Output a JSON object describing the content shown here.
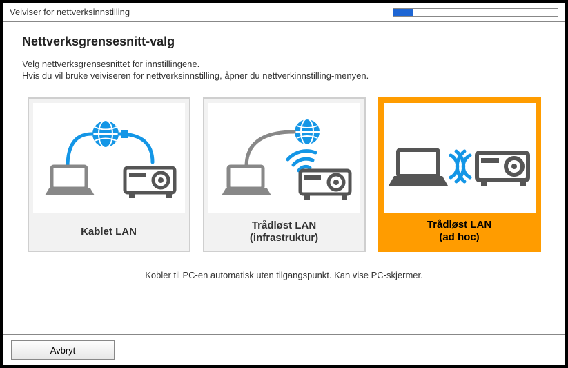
{
  "titlebar": {
    "text": "Veiviser for nettverksinnstilling"
  },
  "heading": "Nettverksgrensesnitt-valg",
  "sub1": "Velg nettverksgrensesnittet for innstillingene.",
  "sub2": "Hvis du vil bruke veiviseren for nettverksinnstilling, åpner du nettverkinnstilling-menyen.",
  "options": {
    "wired": {
      "label1": "Kablet LAN",
      "label2": ""
    },
    "infra": {
      "label1": "Trådløst LAN",
      "label2": "(infrastruktur)"
    },
    "adhoc": {
      "label1": "Trådløst LAN",
      "label2": "(ad hoc)"
    }
  },
  "hint": "Kobler til PC-en automatisk uten tilgangspunkt. Kan vise PC-skjermer.",
  "footer": {
    "cancel": "Avbryt"
  },
  "icons": {
    "globe": "globe-icon",
    "laptop": "laptop-icon",
    "projector": "projector-icon",
    "wifi": "wifi-icon",
    "adhoc_waves": "wireless-waves-icon"
  }
}
